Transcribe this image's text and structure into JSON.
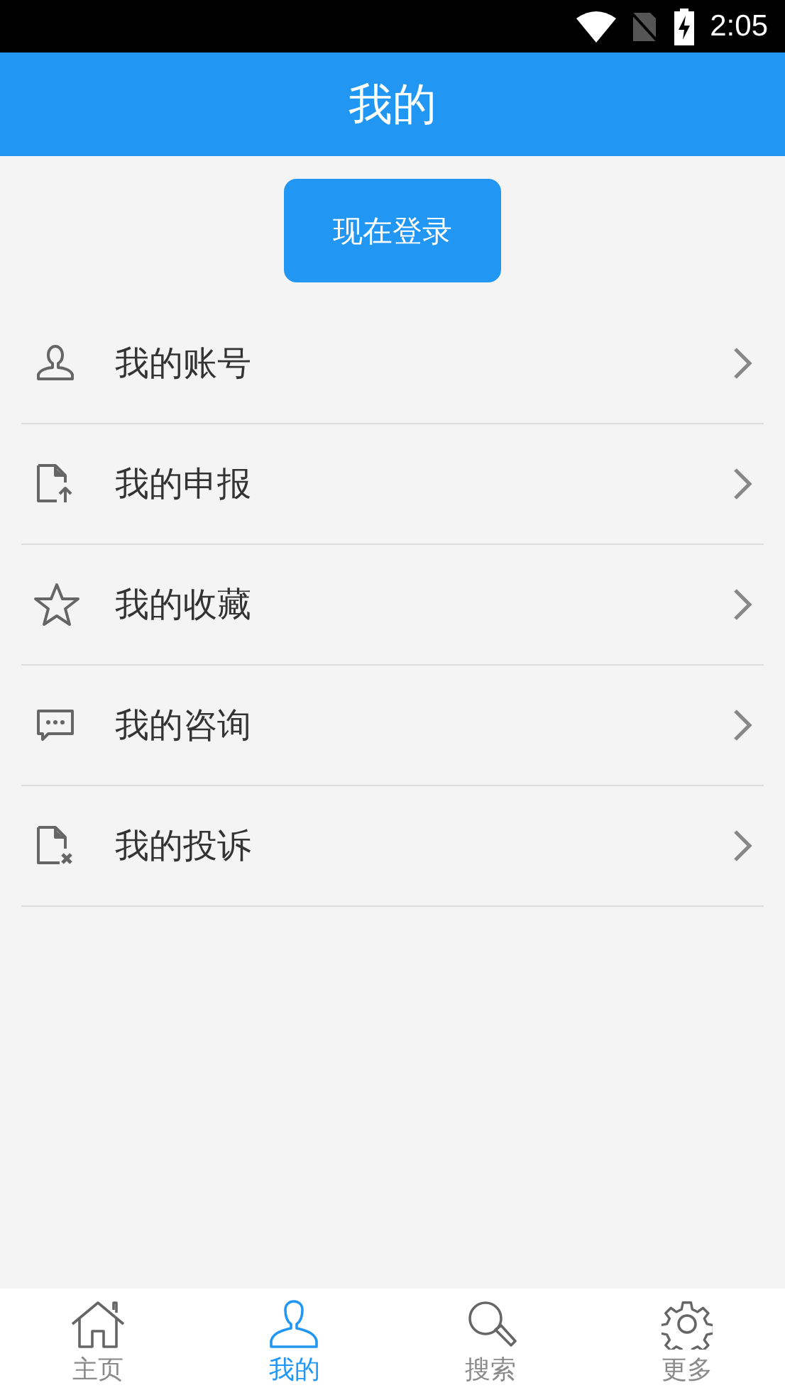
{
  "status_bar": {
    "time": "2:05"
  },
  "header": {
    "title": "我的"
  },
  "login_button": {
    "label": "现在登录"
  },
  "menu": [
    {
      "kind": "account",
      "label": "我的账号"
    },
    {
      "kind": "report",
      "label": "我的申报"
    },
    {
      "kind": "favorite",
      "label": "我的收藏"
    },
    {
      "kind": "consult",
      "label": "我的咨询"
    },
    {
      "kind": "complaint",
      "label": "我的投诉"
    }
  ],
  "tab_bar": [
    {
      "kind": "home",
      "label": "主页",
      "selected": false
    },
    {
      "kind": "profile",
      "label": "我的",
      "selected": true
    },
    {
      "kind": "search",
      "label": "搜索",
      "selected": false
    },
    {
      "kind": "more",
      "label": "更多",
      "selected": false
    }
  ]
}
